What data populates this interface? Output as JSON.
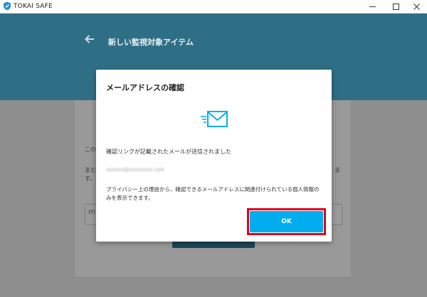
{
  "window": {
    "app_title": "TOKAI SAFE",
    "icon": "shield-icon"
  },
  "header": {
    "back_icon": "back-arrow-icon",
    "title": "新しい監視対象アイテム"
  },
  "background": {
    "text_line1": "この",
    "text_line2a": "また",
    "text_line2b": "す。",
    "text_right1": "ま",
    "input_value": "m"
  },
  "dialog": {
    "title": "メールアドレスの確認",
    "icon": "mail-sent-icon",
    "message": "確認リンクが記載されたメールが送信されました",
    "email": "xxxxxx@xxxxxxxx.com",
    "note": "プライバシー上の理由から、確認できるメールアドレスに関連付けられている個人情報のみを表示できます。",
    "ok_label": "OK"
  },
  "colors": {
    "header_bg": "#2f6f86",
    "accent": "#00aef0",
    "highlight": "#e0001b"
  }
}
